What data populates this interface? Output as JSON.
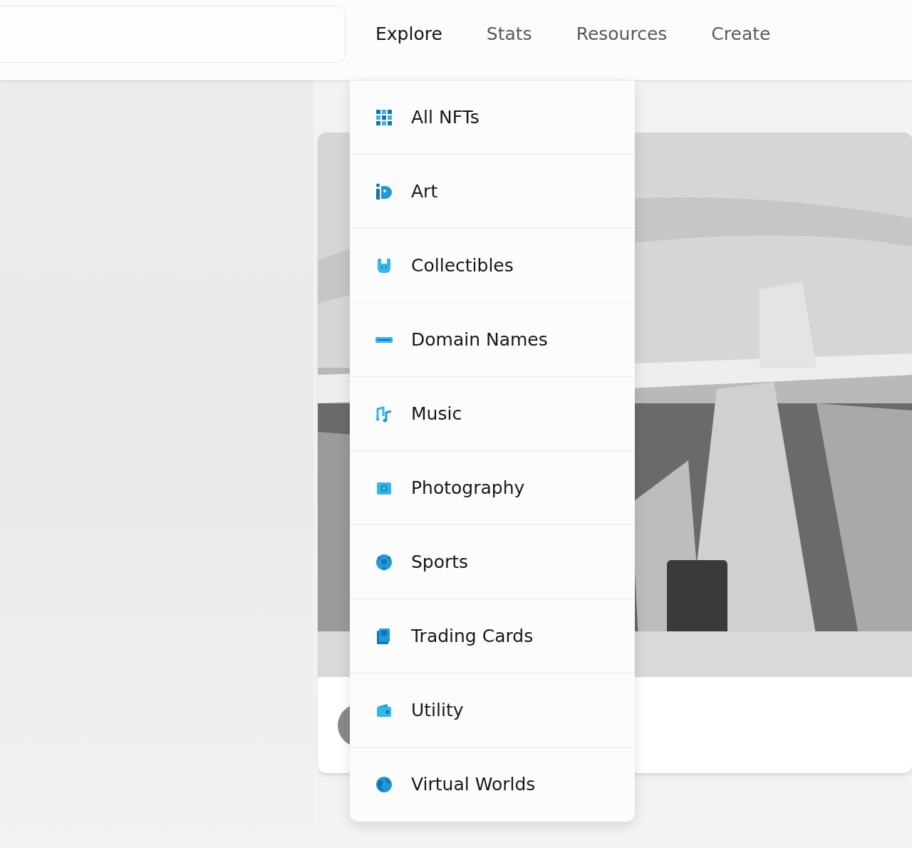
{
  "nav": [
    {
      "label": "Explore",
      "selected": true
    },
    {
      "label": "Stats",
      "selected": false
    },
    {
      "label": "Resources",
      "selected": false
    },
    {
      "label": "Create",
      "selected": false
    }
  ],
  "explore_menu": {
    "items": [
      {
        "label": "All NFTs"
      },
      {
        "label": "Art"
      },
      {
        "label": "Collectibles"
      },
      {
        "label": "Domain Names"
      },
      {
        "label": "Music"
      },
      {
        "label": "Photography"
      },
      {
        "label": "Sports"
      },
      {
        "label": "Trading Cards"
      },
      {
        "label": "Utility"
      },
      {
        "label": "Virtual Worlds"
      }
    ]
  }
}
